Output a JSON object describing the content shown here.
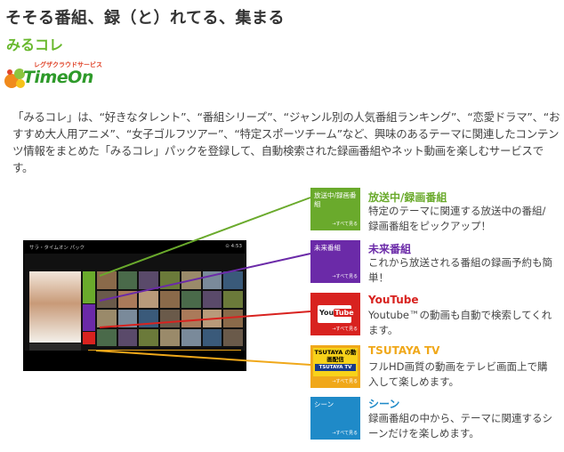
{
  "headline": "そそる番組、録（と）れてる、集まる",
  "subhead": "みるコレ",
  "logo": {
    "tagline": "レグザクラウドサービス",
    "wordmark": "TimeOn"
  },
  "description": "「みるコレ」は、“好きなタレント”、“番組シリーズ”、“ジャンル別の人気番組ランキング”、“恋愛ドラマ”、“おすすめ大人用アニメ”、“女子ゴルフツアー”、“特定スポーツチーム”など、興味のあるテーマに関連したコンテンツ情報をまとめた「みるコレ」パックを登録して、自動検索された録画番組やネット動画を楽しむサービスです。",
  "tv": {
    "bar_title": "サラ・タイムオン パック",
    "bar_right": "⊙ 4:53"
  },
  "colors": {
    "green": "#6aaa2c",
    "purple": "#6b2aa8",
    "red": "#d8221f",
    "yellow": "#f0a81a",
    "blue": "#1f8ac8"
  },
  "services": [
    {
      "tile_label": "放送中/録画番組",
      "tile_more": "→すべて見る",
      "title": "放送中/録画番組",
      "text": "特定のテーマに関連する放送中の番組/録画番組をピックアップ！"
    },
    {
      "tile_label": "未来番組",
      "tile_more": "→すべて見る",
      "title": "未来番組",
      "text": "これから放送される番組の録画予約も簡単！"
    },
    {
      "tile_label": "YouTube",
      "tile_more": "→すべて見る",
      "title": "YouTube",
      "text": "Youtube™の動画も自動で検索してくれます。"
    },
    {
      "tile_label": "TSUTAYA の動画配信",
      "tile_strip": "TSUTAYA TV",
      "tile_more": "→すべて見る",
      "title": "TSUTAYA TV",
      "text": "フルHD画質の動画をテレビ画面上で購入して楽しめます。"
    },
    {
      "tile_label": "シーン",
      "tile_more": "→すべて見る",
      "title": "シーン",
      "text": "録画番組の中から、テーマに関連するシーンだけを楽しめます。"
    }
  ]
}
